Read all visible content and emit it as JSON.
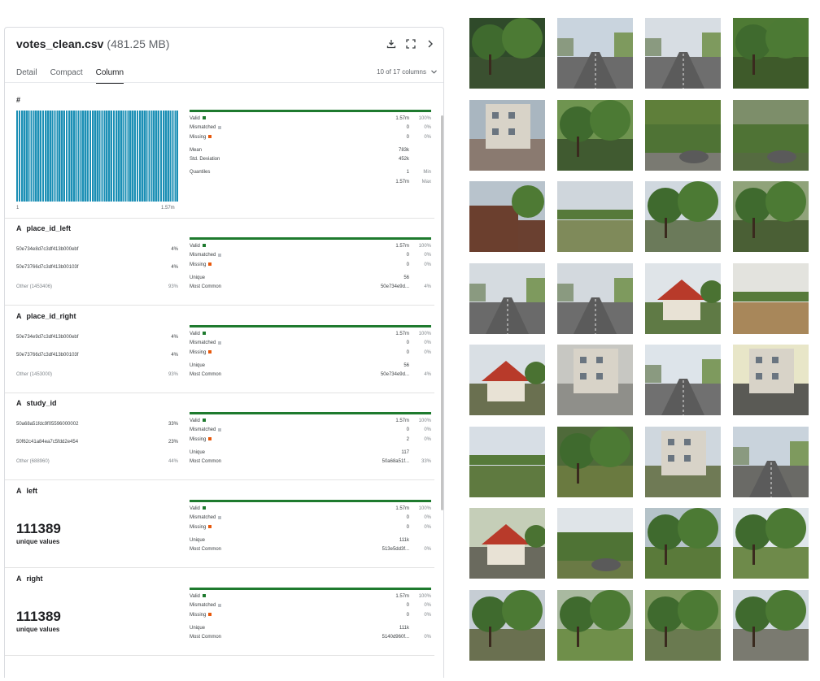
{
  "header": {
    "filename": "votes_clean.csv",
    "size": "(481.25 MB)",
    "icons": [
      "download-icon",
      "fullscreen-icon",
      "chevron-right-icon"
    ]
  },
  "tabs": [
    {
      "label": "Detail",
      "active": false
    },
    {
      "label": "Compact",
      "active": false
    },
    {
      "label": "Column",
      "active": true
    }
  ],
  "column_selector": {
    "label": "10 of 17 columns"
  },
  "legend_colors": {
    "valid": "#1e7a2e",
    "mismatched": "#bdc1c6",
    "missing": "#e8590c",
    "histogram": "#1b8fb5"
  },
  "columns": [
    {
      "name": "#",
      "type_icon": "",
      "hist_min": "1",
      "hist_max": "1.57m",
      "stats": {
        "valid": {
          "label": "Valid",
          "value": "1.57m",
          "pct": "100%"
        },
        "mismatched": {
          "label": "Mismatched",
          "value": "0",
          "pct": "0%"
        },
        "missing": {
          "label": "Missing",
          "value": "0",
          "pct": "0%"
        },
        "mean": {
          "label": "Mean",
          "value": "783k"
        },
        "std": {
          "label": "Std. Deviation",
          "value": "452k"
        },
        "quantiles": {
          "label": "Quantiles",
          "min_value": "1",
          "min_label": "Min",
          "max_value": "1.57m",
          "max_label": "Max"
        }
      }
    },
    {
      "name": "place_id_left",
      "type_icon": "A",
      "values": [
        {
          "label": "50e734e8d7c3df413b000ebf",
          "pct": "4%"
        },
        {
          "label": "50e73766d7c3df413b00103f",
          "pct": "4%"
        },
        {
          "label": "Other (1453406)",
          "pct": "93%"
        }
      ],
      "stats": {
        "valid": {
          "label": "Valid",
          "value": "1.57m",
          "pct": "100%"
        },
        "mismatched": {
          "label": "Mismatched",
          "value": "0",
          "pct": "0%"
        },
        "missing": {
          "label": "Missing",
          "value": "0",
          "pct": "0%"
        },
        "unique": {
          "label": "Unique",
          "value": "56"
        },
        "common": {
          "label": "Most Common",
          "value": "50e734e9d...",
          "pct": "4%"
        }
      }
    },
    {
      "name": "place_id_right",
      "type_icon": "A",
      "values": [
        {
          "label": "50e734e9d7c3df413b000ebf",
          "pct": "4%"
        },
        {
          "label": "50e73766d7c3df413b00103f",
          "pct": "4%"
        },
        {
          "label": "Other (1453000)",
          "pct": "93%"
        }
      ],
      "stats": {
        "valid": {
          "label": "Valid",
          "value": "1.57m",
          "pct": "100%"
        },
        "mismatched": {
          "label": "Mismatched",
          "value": "0",
          "pct": "0%"
        },
        "missing": {
          "label": "Missing",
          "value": "0",
          "pct": "0%"
        },
        "unique": {
          "label": "Unique",
          "value": "56"
        },
        "common": {
          "label": "Most Common",
          "value": "50e734e9d...",
          "pct": "4%"
        }
      }
    },
    {
      "name": "study_id",
      "type_icon": "A",
      "values": [
        {
          "label": "50a68a51fdc9f05596000002",
          "pct": "33%"
        },
        {
          "label": "50f62c41a84ea7c5fdd2e454",
          "pct": "23%"
        },
        {
          "label": "Other (688960)",
          "pct": "44%"
        }
      ],
      "stats": {
        "valid": {
          "label": "Valid",
          "value": "1.57m",
          "pct": "100%"
        },
        "mismatched": {
          "label": "Mismatched",
          "value": "0",
          "pct": "0%"
        },
        "missing": {
          "label": "Missing",
          "value": "2",
          "pct": "0%"
        },
        "unique": {
          "label": "Unique",
          "value": "117"
        },
        "common": {
          "label": "Most Common",
          "value": "50a68a51f...",
          "pct": "33%"
        }
      }
    },
    {
      "name": "left",
      "type_icon": "A",
      "big_value": "111389",
      "big_label": "unique values",
      "stats": {
        "valid": {
          "label": "Valid",
          "value": "1.57m",
          "pct": "100%"
        },
        "mismatched": {
          "label": "Mismatched",
          "value": "0",
          "pct": "0%"
        },
        "missing": {
          "label": "Missing",
          "value": "0",
          "pct": "0%"
        },
        "unique": {
          "label": "Unique",
          "value": "111k"
        },
        "common": {
          "label": "Most Common",
          "value": "513e5dd3f...",
          "pct": "0%"
        }
      }
    },
    {
      "name": "right",
      "type_icon": "A",
      "big_value": "111389",
      "big_label": "unique values",
      "stats": {
        "valid": {
          "label": "Valid",
          "value": "1.57m",
          "pct": "100%"
        },
        "mismatched": {
          "label": "Mismatched",
          "value": "0",
          "pct": "0%"
        },
        "missing": {
          "label": "Missing",
          "value": "0",
          "pct": "0%"
        },
        "unique": {
          "label": "Unique",
          "value": "111k"
        },
        "common": {
          "label": "Most Common",
          "value": "5140d960f...",
          "pct": "0%"
        }
      }
    }
  ],
  "photos": [
    {
      "sky": "#2f4a2a",
      "ground": "#3a5030",
      "feature": "trees"
    },
    {
      "sky": "#c9d4de",
      "ground": "#6b6b6b",
      "feature": "road"
    },
    {
      "sky": "#d7dde3",
      "ground": "#6e6e6e",
      "feature": "road"
    },
    {
      "sky": "#4e7a34",
      "ground": "#3e5a2a",
      "feature": "trees"
    },
    {
      "sky": "#a9b6c0",
      "ground": "#8a7a70",
      "feature": "building"
    },
    {
      "sky": "#6f9450",
      "ground": "#405a30",
      "feature": "trees"
    },
    {
      "sky": "#5f7f3a",
      "ground": "#7a7a72",
      "feature": "hedge"
    },
    {
      "sky": "#7d8e6a",
      "ground": "#556b40",
      "feature": "hedge"
    },
    {
      "sky": "#b8c3cc",
      "ground": "#6a4030",
      "feature": "wall"
    },
    {
      "sky": "#cfd6dc",
      "ground": "#7f8a5a",
      "feature": "field"
    },
    {
      "sky": "#d0d8df",
      "ground": "#6b7a5a",
      "feature": "trees"
    },
    {
      "sky": "#90a37a",
      "ground": "#4a5f35",
      "feature": "trees"
    },
    {
      "sky": "#d5dbe0",
      "ground": "#6a6a6a",
      "feature": "road"
    },
    {
      "sky": "#d3d9de",
      "ground": "#6d6d6d",
      "feature": "road"
    },
    {
      "sky": "#dfe4e8",
      "ground": "#5f7a45",
      "feature": "house"
    },
    {
      "sky": "#e3e3de",
      "ground": "#a8875a",
      "feature": "field"
    },
    {
      "sky": "#d9dfe4",
      "ground": "#6a7050",
      "feature": "house"
    },
    {
      "sky": "#c7c7c2",
      "ground": "#8f8f8a",
      "feature": "building"
    },
    {
      "sky": "#dde4ea",
      "ground": "#707070",
      "feature": "road"
    },
    {
      "sky": "#e8e6c8",
      "ground": "#5a5a55",
      "feature": "building"
    },
    {
      "sky": "#d7dee5",
      "ground": "#5f7a40",
      "feature": "field"
    },
    {
      "sky": "#4f6a3a",
      "ground": "#6a7a40",
      "feature": "trees"
    },
    {
      "sky": "#cfd7de",
      "ground": "#6f7a55",
      "feature": "building"
    },
    {
      "sky": "#c9d3dc",
      "ground": "#6a6a66",
      "feature": "road"
    },
    {
      "sky": "#c5ceb8",
      "ground": "#6a6a5e",
      "feature": "house"
    },
    {
      "sky": "#dfe4e8",
      "ground": "#6a7a45",
      "feature": "hedge"
    },
    {
      "sky": "#b5c3c9",
      "ground": "#5a7a3a",
      "feature": "trees"
    },
    {
      "sky": "#dfe6ea",
      "ground": "#6e8a4a",
      "feature": "trees"
    },
    {
      "sky": "#c6cdd4",
      "ground": "#6a7050",
      "feature": "trees"
    },
    {
      "sky": "#a9b9a0",
      "ground": "#6f8f4a",
      "feature": "trees"
    },
    {
      "sky": "#7f9a60",
      "ground": "#6a7a50",
      "feature": "trees"
    },
    {
      "sky": "#cfd8de",
      "ground": "#7a7a70",
      "feature": "trees"
    }
  ]
}
